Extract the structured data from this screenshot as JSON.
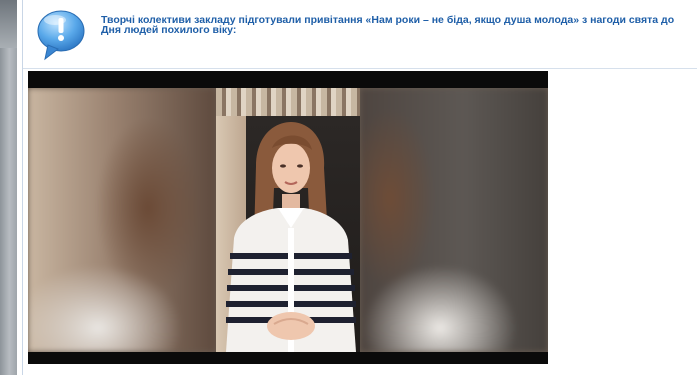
{
  "post": {
    "title": "Творчі колективи закладу підготували привітання «Нам роки – не біда, якщо душа молода»  з нагоди свята до Дня людей похилого віку:",
    "icon": "info-bubble-icon",
    "accent_color": "#1f5fa8"
  }
}
